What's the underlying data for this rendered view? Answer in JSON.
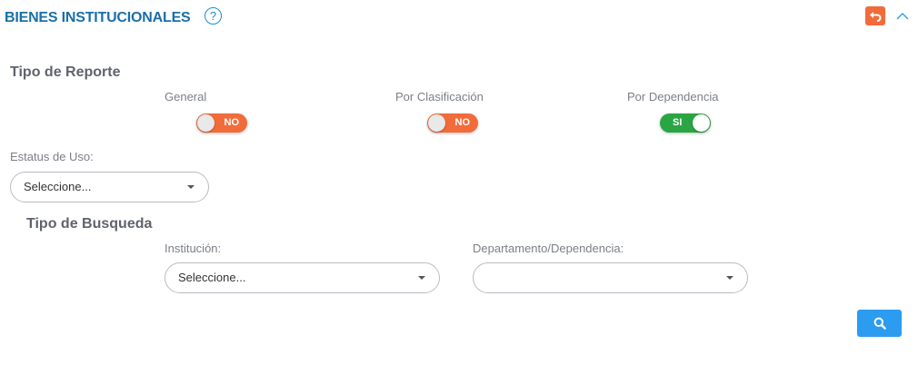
{
  "header": {
    "title": "BIENES INSTITUCIONALES",
    "help_glyph": "?",
    "help_icon": "question-circle-icon",
    "back_icon": "undo-arrow-icon",
    "collapse_icon": "chevron-up-icon"
  },
  "tipo_reporte": {
    "title": "Tipo de Reporte",
    "options": [
      {
        "label": "General",
        "state": "NO"
      },
      {
        "label": "Por Clasificación",
        "state": "NO"
      },
      {
        "label": "Por Dependencia",
        "state": "SI"
      }
    ]
  },
  "estatus": {
    "label": "Estatus de Uso:",
    "value": "Seleccione..."
  },
  "tipo_busqueda": {
    "title": "Tipo de Busqueda",
    "institucion": {
      "label": "Institución:",
      "value": "Seleccione..."
    },
    "departamento": {
      "label": "Departamento/Dependencia:",
      "value": ""
    }
  },
  "search_button": {
    "icon": "search-icon"
  },
  "colors": {
    "title_blue": "#1a6fa8",
    "toggle_off": "#f26b3a",
    "toggle_on": "#2aa544",
    "button_blue": "#2c9cf0"
  }
}
